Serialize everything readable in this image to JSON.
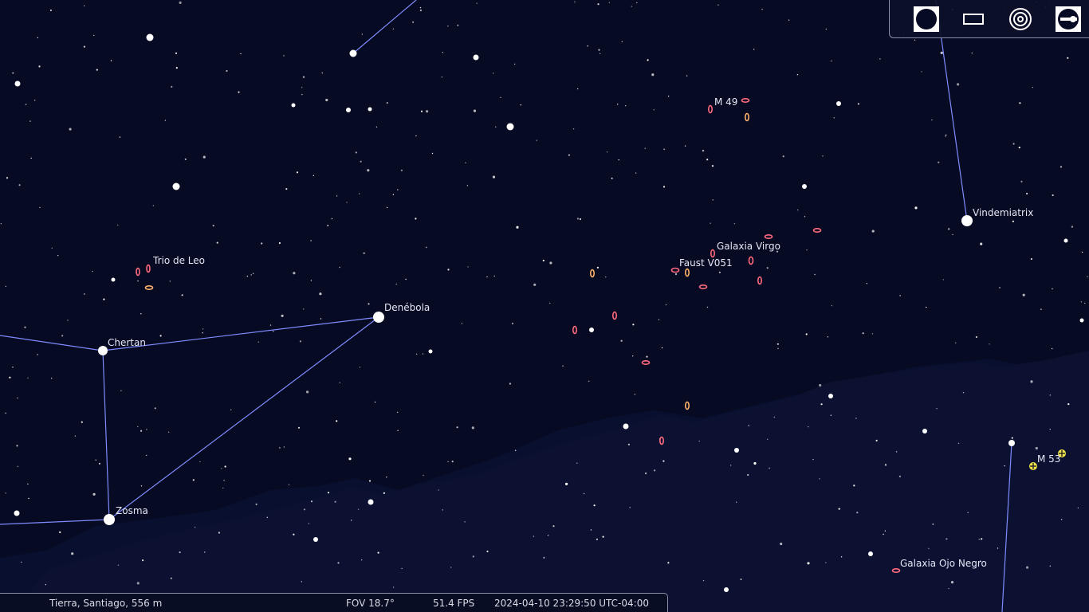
{
  "app": "Stellarium",
  "colors": {
    "sky": "#060a22",
    "ground": "#0c1030",
    "constellation_line": "#7f8cff",
    "star": "#ffffff",
    "label": "#e4e7f5",
    "galaxy_marker": "#ff6a7f",
    "galaxy_marker_alt": "#ffb26a",
    "cluster_marker": "#f2e24a"
  },
  "sky_labels": {
    "trio_de_leo": "Trio de Leo",
    "denebola": "Denébola",
    "chertan": "Chertan",
    "zosma": "Zosma",
    "m49": "M 49",
    "vindemiatrix": "Vindemiatrix",
    "galaxia_virgo": "Galaxia Virgo",
    "faust_v051": "Faust V051",
    "m53": "M 53",
    "galaxia_ojo_negro": "Galaxia Ojo Negro"
  },
  "toolbar": {
    "items": [
      {
        "icon": "full-circle-icon",
        "active": true
      },
      {
        "icon": "rectangle-frame-icon",
        "active": false
      },
      {
        "icon": "concentric-circles-icon",
        "active": false
      },
      {
        "icon": "telescope-eyepiece-icon",
        "active": false
      }
    ]
  },
  "status": {
    "location": "Tierra, Santiago, 556 m",
    "fov": "FOV 18.7°",
    "fps": "51.4 FPS",
    "datetime": "2024-04-10 23:29:50 UTC-04:00"
  }
}
